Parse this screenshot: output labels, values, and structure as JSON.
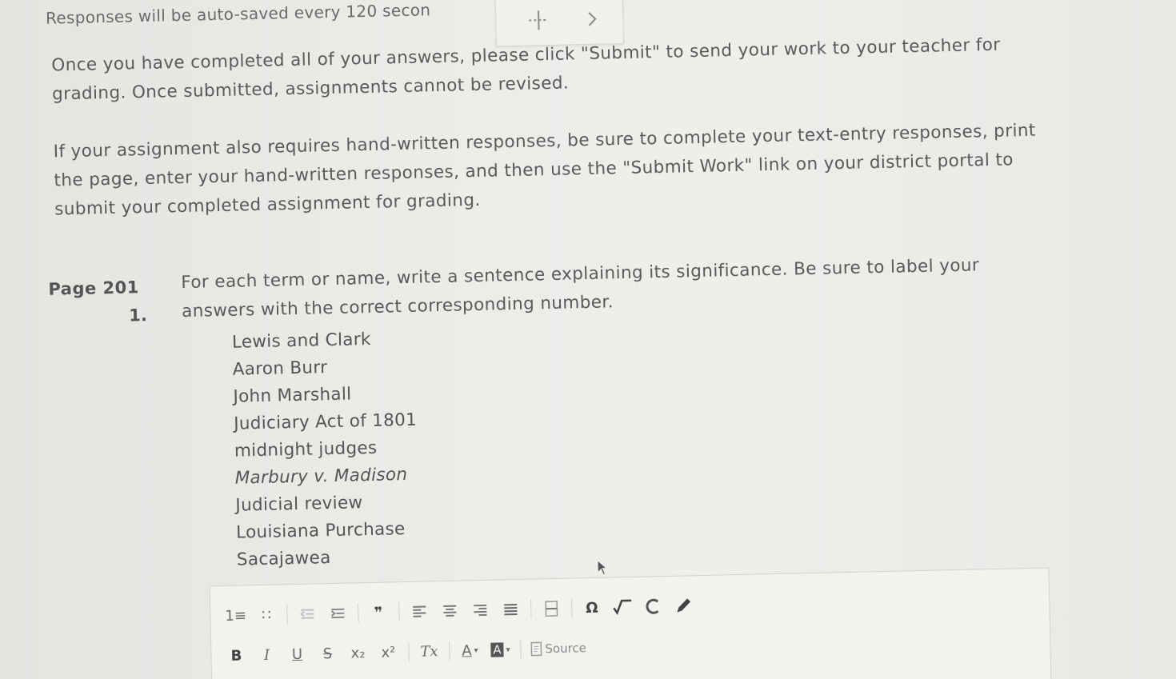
{
  "autosave_notice": "Responses will be auto-saved every 120 secon",
  "instructions": {
    "submit_line1": "Once you have completed all of your answers, please click \"Submit\" to send your work to your teacher for",
    "submit_line2": "grading. Once submitted, assignments cannot be revised.",
    "handwritten_line1": "If your assignment also requires hand-written responses, be sure to complete your text-entry responses, print",
    "handwritten_line2": "the page, enter your hand-written responses, and then use the \"Submit Work\" link on your district portal to",
    "handwritten_line3": "submit your completed assignment for grading."
  },
  "question": {
    "page_label": "Page 201",
    "number": "1.",
    "prompt_line1": "For each term or name, write a sentence explaining its significance. Be sure to label your",
    "prompt_line2": "answers with the correct corresponding number.",
    "terms": [
      "Lewis and Clark",
      "Aaron Burr",
      "John Marshall",
      "Judiciary Act of 1801",
      "midnight judges",
      "Marbury v. Madison",
      "Judicial review",
      "Louisiana Purchase",
      "Sacajawea"
    ]
  },
  "editor_toolbar": {
    "row1": {
      "numbered_list": "1≡",
      "bulleted_list": "∷",
      "blockquote": "❞",
      "special_char": "Ω"
    },
    "row2": {
      "bold": "B",
      "italic": "I",
      "underline": "U",
      "strike": "S",
      "subscript": "x₂",
      "superscript": "x²",
      "remove_format": "Tx",
      "text_color": "A",
      "bg_color": "A",
      "source": "Source"
    }
  }
}
